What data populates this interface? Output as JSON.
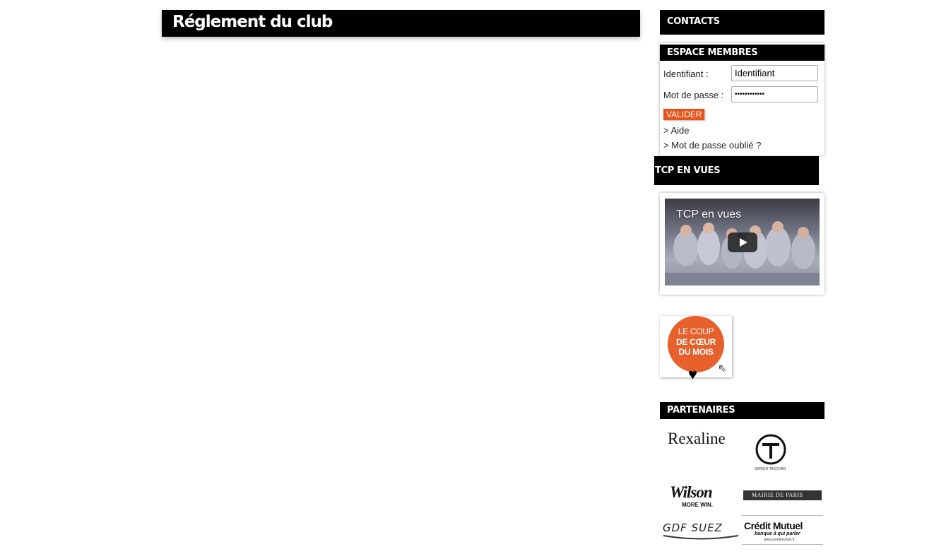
{
  "main": {
    "title": "Réglement du club"
  },
  "sidebar": {
    "contacts_label": "CONTACTS",
    "members": {
      "title": "ESPACE MEMBRES",
      "username_label": "Identifiant :",
      "username_value": "Identifiant",
      "password_label": "Mot de passe :",
      "password_value": "••••••••••••",
      "submit_label": "VALIDER",
      "help_link": "> Aide",
      "forgot_link": "> Mot de passe oublié ?"
    },
    "tcp": {
      "title": "TCP EN VUES",
      "video_title": "TCP en vues"
    },
    "coup_de_coeur": {
      "line1": "LE COUP",
      "line2": "DE CŒUR",
      "line3": "DU MOIS"
    },
    "partners": {
      "title": "PARTENAIRES",
      "items": [
        "Rexaline",
        "SERGIO TACCHINI",
        "Wilson",
        "MORE WIN.",
        "MAIRIE DE PARIS",
        "GDF SUEZ",
        "Crédit Mutuel",
        "banque à qui parler",
        "www.creditmutuel.fr"
      ]
    }
  },
  "colors": {
    "bar": "#000000",
    "accent": "#e8531c",
    "coup": "#e8602c"
  }
}
